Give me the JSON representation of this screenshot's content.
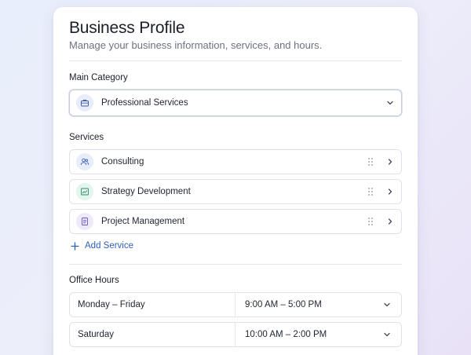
{
  "header": {
    "title": "Business Profile",
    "subtitle": "Manage your business information, services, and hours."
  },
  "category": {
    "label": "Main Category",
    "selected": "Professional Services",
    "icon": "briefcase-icon",
    "accent": "#e8ecfb"
  },
  "services": {
    "label": "Services",
    "items": [
      {
        "label": "Consulting",
        "icon": "users-icon",
        "icon_bg": "#e7edfb",
        "icon_color": "#3d5fae"
      },
      {
        "label": "Strategy Development",
        "icon": "chart-icon",
        "icon_bg": "#e3f6ee",
        "icon_color": "#2e8b62"
      },
      {
        "label": "Project Management",
        "icon": "document-icon",
        "icon_bg": "#eeeaf9",
        "icon_color": "#6b58b8"
      }
    ],
    "add_label": "Add Service"
  },
  "office_hours": {
    "label": "Office Hours",
    "rows": [
      {
        "day": "Monday – Friday",
        "time": "9:00 AM – 5:00 PM"
      },
      {
        "day": "Saturday",
        "time": "10:00 AM – 2:00 PM"
      }
    ]
  },
  "colors": {
    "link": "#2f5fb8",
    "border": "#dfe2ea"
  }
}
